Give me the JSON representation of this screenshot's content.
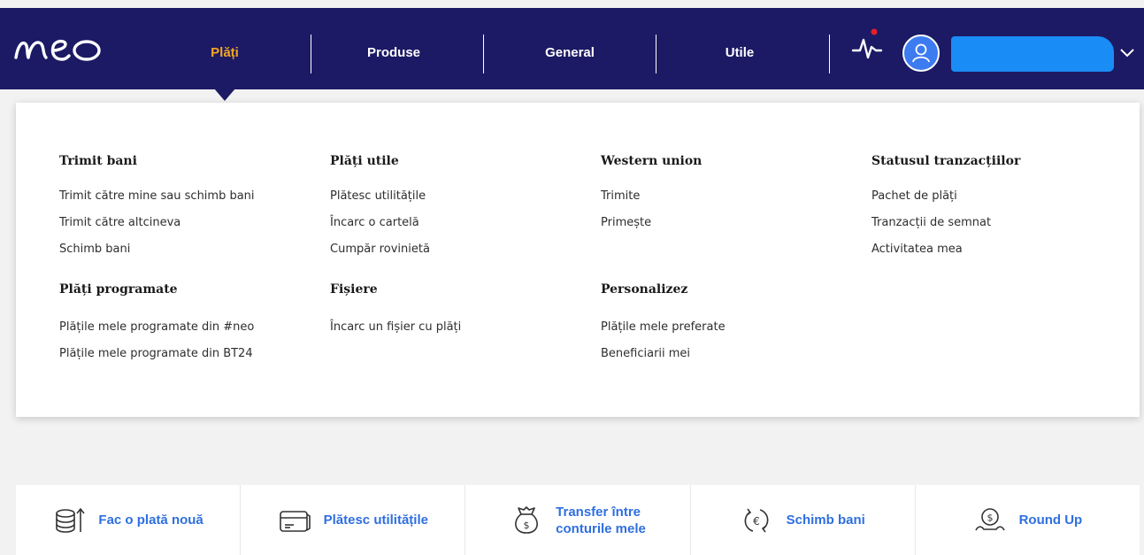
{
  "brand": {
    "logo_text": "neo"
  },
  "nav": {
    "items": [
      {
        "label": "Plăți",
        "active": true
      },
      {
        "label": "Produse",
        "active": false
      },
      {
        "label": "General",
        "active": false
      },
      {
        "label": "Utile",
        "active": false
      }
    ],
    "icons": [
      "activity-icon",
      "user-icon",
      "chevron-down-icon"
    ]
  },
  "menu": {
    "columns": [
      {
        "title": "Trimit bani",
        "links": [
          "Trimit către mine sau schimb bani",
          "Trimit către altcineva",
          "Schimb bani"
        ]
      },
      {
        "title": "Plăți utile",
        "links": [
          "Plătesc utilitățile",
          "Încarc o cartelă",
          "Cumpăr rovinietă"
        ]
      },
      {
        "title": "Western union",
        "links": [
          "Trimite",
          "Primește"
        ]
      },
      {
        "title": "Statusul tranzacțiilor",
        "links": [
          "Pachet de plăți",
          "Tranzacții de semnat",
          "Activitatea mea"
        ]
      },
      {
        "title": "Plăți programate",
        "links": [
          "Plățile mele programate din #neo",
          "Plățile mele programate din BT24"
        ]
      },
      {
        "title": "Fișiere",
        "links": [
          "Încarc un fișier cu plăți"
        ]
      },
      {
        "title": "Personalizez",
        "links": [
          "Plățile mele preferate",
          "Beneficiarii mei"
        ]
      }
    ]
  },
  "quick_actions": [
    {
      "label": "Fac o plată nouă",
      "icon": "coins-arrow-icon"
    },
    {
      "label": "Plătesc utilitățile",
      "icon": "card-icon"
    },
    {
      "label_line1": "Transfer între",
      "label_line2": "conturile mele",
      "icon": "money-bag-icon"
    },
    {
      "label": "Schimb bani",
      "icon": "euro-exchange-icon"
    },
    {
      "label": "Round Up",
      "icon": "coin-hand-icon"
    }
  ],
  "colors": {
    "nav_bg": "#1c1a64",
    "nav_active": "#f5a623",
    "link_blue": "#2f6fe0",
    "page_bg": "#f2f2f2"
  }
}
